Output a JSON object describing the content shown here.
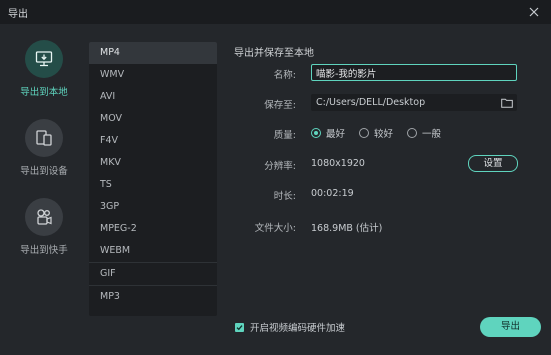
{
  "window": {
    "title": "导出"
  },
  "nav": {
    "items": [
      {
        "label": "导出到本地",
        "active": true
      },
      {
        "label": "导出到设备",
        "active": false
      },
      {
        "label": "导出到快手",
        "active": false
      }
    ]
  },
  "formats": {
    "items": [
      "MP4",
      "WMV",
      "AVI",
      "MOV",
      "F4V",
      "MKV",
      "TS",
      "3GP",
      "MPEG-2",
      "WEBM",
      "GIF",
      "MP3"
    ],
    "selected": "MP4"
  },
  "details": {
    "section_title": "导出并保存至本地",
    "name_label": "名称:",
    "name_value": "喵影-我的影片",
    "save_label": "保存至:",
    "save_path": "C:/Users/DELL/Desktop",
    "quality_label": "质量:",
    "quality_options": [
      "最好",
      "较好",
      "一般"
    ],
    "quality_selected": "最好",
    "resolution_label": "分辨率:",
    "resolution_value": "1080x1920",
    "settings_button": "设置",
    "duration_label": "时长:",
    "duration_value": "00:02:19",
    "filesize_label": "文件大小:",
    "filesize_value": "168.9MB (估计)"
  },
  "footer": {
    "hw_accel_label": "开启视频编码硬件加速",
    "hw_accel_checked": true,
    "export_button": "导出"
  },
  "colors": {
    "accent": "#5fd4be",
    "background": "#24272b",
    "titlebar": "#1a1c1f"
  },
  "icons": [
    "close-icon",
    "monitor-download-icon",
    "devices-icon",
    "kuaishou-camera-icon",
    "folder-icon",
    "check-icon"
  ]
}
